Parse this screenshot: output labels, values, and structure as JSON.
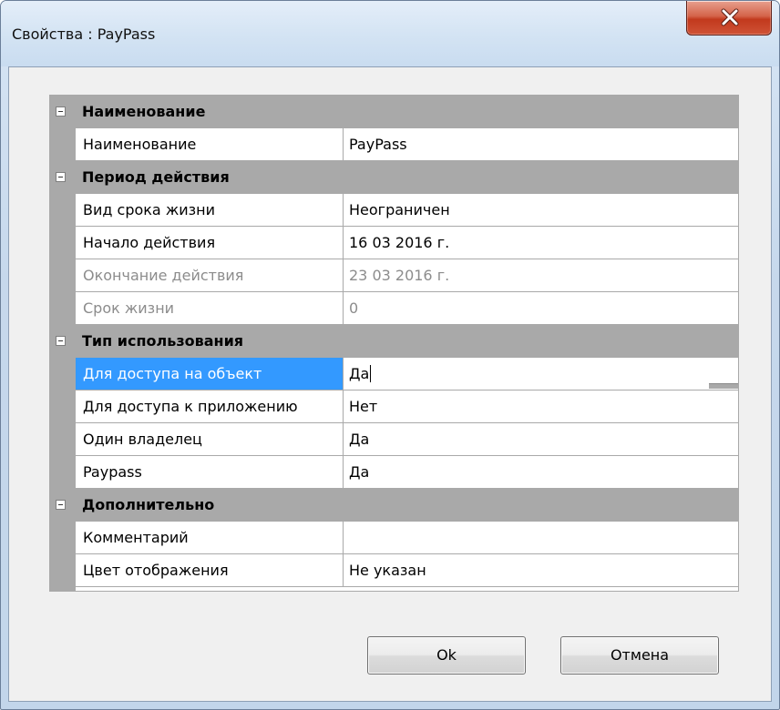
{
  "window": {
    "title": "Свойства : PayPass",
    "close_glyph": "close-icon"
  },
  "grid": {
    "categories": [
      {
        "label": "Наименование",
        "properties": [
          {
            "name": "Наименование",
            "value": "PayPass"
          }
        ]
      },
      {
        "label": "Период действия",
        "properties": [
          {
            "name": "Вид срока жизни",
            "value": "Неограничен"
          },
          {
            "name": "Начало действия",
            "value": "16 03 2016 г."
          },
          {
            "name": "Окончание действия",
            "value": "23 03 2016 г.",
            "disabled": true
          },
          {
            "name": "Срок жизни",
            "value": "0",
            "disabled": true
          }
        ]
      },
      {
        "label": "Тип использования",
        "properties": [
          {
            "name": "Для доступа на объект",
            "value": "Да",
            "selected": true
          },
          {
            "name": "Для доступа к приложению",
            "value": "Нет"
          },
          {
            "name": "Один владелец",
            "value": "Да"
          },
          {
            "name": "Paypass",
            "value": "Да"
          }
        ]
      },
      {
        "label": "Дополнительно",
        "properties": [
          {
            "name": "Комментарий",
            "value": ""
          },
          {
            "name": "Цвет отображения",
            "value": "Не указан"
          }
        ]
      }
    ]
  },
  "buttons": {
    "ok_label": "Ok",
    "cancel_label": "Отмена"
  },
  "colors": {
    "selection": "#3399ff",
    "category_bg": "#a9a9a9",
    "disabled_text": "#8c8c8c",
    "close_button": "#c2391d"
  }
}
